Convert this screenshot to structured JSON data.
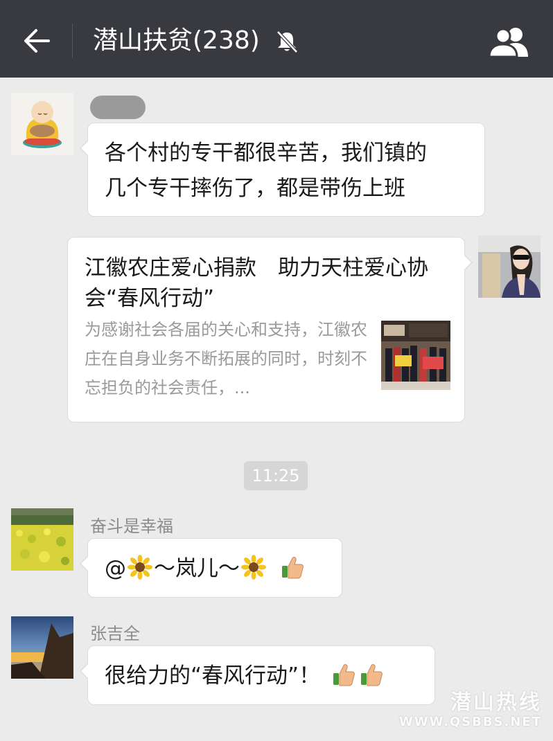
{
  "header": {
    "title": "潜山扶贫(238)",
    "back_icon": "back-arrow-icon",
    "mute_icon": "bell-off-icon",
    "members_icon": "group-members-icon"
  },
  "messages": [
    {
      "sender": "",
      "side": "left",
      "lines": [
        "各个村的专干都很辛苦，我们镇的",
        "几个专干摔伤了，都是带伤上班"
      ]
    },
    {
      "side": "right",
      "type": "link-card",
      "card_title": "江徽农庄爱心捐款　助力天柱爱心协会“春风行动”",
      "card_desc": "为感谢社会各届的关心和支持，江徽农庄在自身业务不断拓展的同时，时刻不忘担负的社会责任，..."
    },
    {
      "sender": "奋斗是幸福",
      "side": "left",
      "parts": [
        "@",
        "～岚儿～",
        ""
      ]
    },
    {
      "sender": "张吉全",
      "side": "left",
      "text": "很给力的“春风行动”！"
    }
  ],
  "timestamp": "11:25",
  "watermark": {
    "cn": "潜山热线",
    "en": "WWW.QSBBS.NET"
  },
  "colors": {
    "topbar": "#393a3f",
    "background": "#ebebeb",
    "bubble": "#ffffff"
  }
}
